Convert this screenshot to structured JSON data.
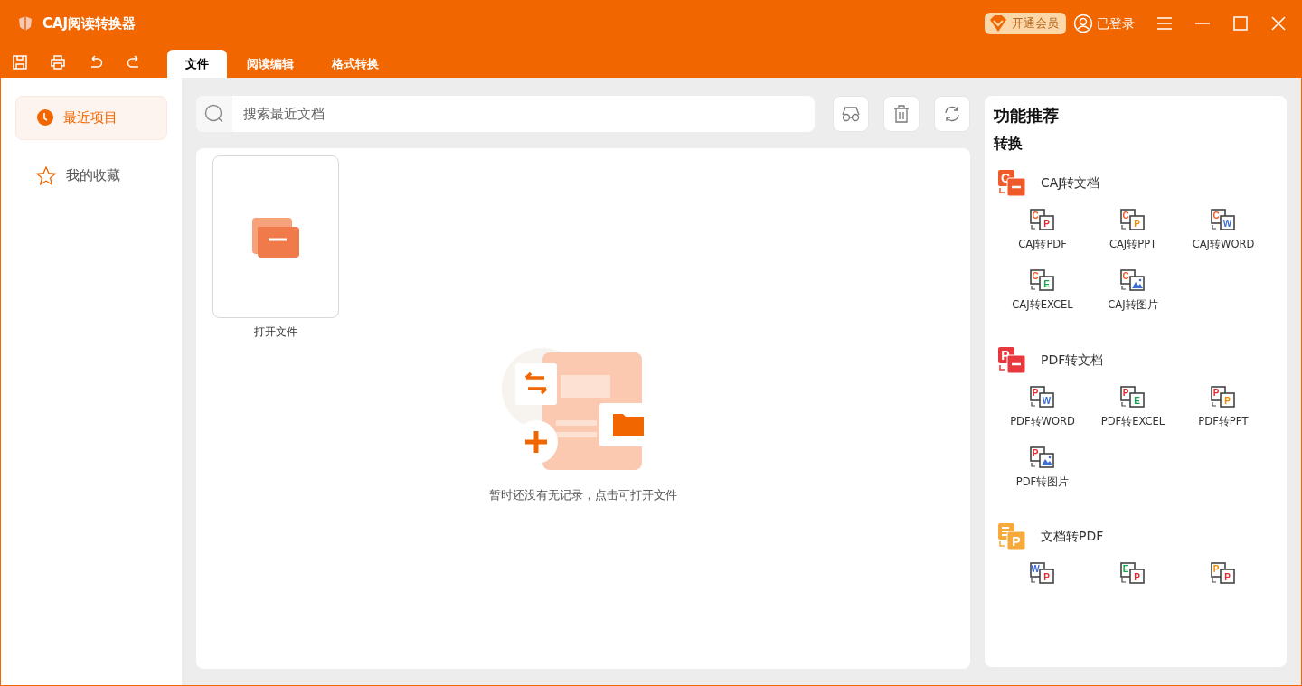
{
  "window": {
    "title": "CAJ阅读转换器",
    "vip_button": "开通会员",
    "user": "已登录"
  },
  "tabs": [
    {
      "label": "文件",
      "selected": true
    },
    {
      "label": "阅读编辑",
      "selected": false
    },
    {
      "label": "格式转换",
      "selected": false
    }
  ],
  "sidebar": {
    "items": [
      {
        "label": "最近项目",
        "kind": "clock",
        "selected": true
      },
      {
        "label": "我的收藏",
        "kind": "star",
        "selected": false
      }
    ]
  },
  "search": {
    "placeholder": "搜索最近文档"
  },
  "open_tile": {
    "label": "打开文件"
  },
  "empty_message": "暂时还没有无记录，点击可打开文件",
  "panel": {
    "title": "功能推荐",
    "subtitle": "转换",
    "sections": [
      {
        "title": "CAJ转文档",
        "color": "#f05a28",
        "icon_from": "C",
        "items": [
          {
            "label": "CAJ转PDF",
            "from": {
              "letter": "C",
              "color": "#f05a28"
            },
            "to": {
              "kind": "letter",
              "letter": "P",
              "color": "#e8262d"
            }
          },
          {
            "label": "CAJ转PPT",
            "from": {
              "letter": "C",
              "color": "#f05a28"
            },
            "to": {
              "kind": "letter",
              "letter": "P",
              "color": "#f08a00"
            }
          },
          {
            "label": "CAJ转WORD",
            "from": {
              "letter": "C",
              "color": "#f05a28"
            },
            "to": {
              "kind": "letter",
              "letter": "W",
              "color": "#3d6fd1"
            }
          },
          {
            "label": "CAJ转EXCEL",
            "from": {
              "letter": "C",
              "color": "#f05a28"
            },
            "to": {
              "kind": "letter",
              "letter": "E",
              "color": "#15a550"
            }
          },
          {
            "label": "CAJ转图片",
            "from": {
              "letter": "C",
              "color": "#f05a28"
            },
            "to": {
              "kind": "image"
            }
          }
        ]
      },
      {
        "title": "PDF转文档",
        "color": "#e8383d",
        "icon_from": "P",
        "items": [
          {
            "label": "PDF转WORD",
            "from": {
              "letter": "P",
              "color": "#e8262d"
            },
            "to": {
              "kind": "letter",
              "letter": "W",
              "color": "#3d6fd1"
            }
          },
          {
            "label": "PDF转EXCEL",
            "from": {
              "letter": "P",
              "color": "#e8262d"
            },
            "to": {
              "kind": "letter",
              "letter": "E",
              "color": "#15a550"
            }
          },
          {
            "label": "PDF转PPT",
            "from": {
              "letter": "P",
              "color": "#e8262d"
            },
            "to": {
              "kind": "letter",
              "letter": "P",
              "color": "#f08a00"
            }
          },
          {
            "label": "PDF转图片",
            "from": {
              "letter": "P",
              "color": "#e8262d"
            },
            "to": {
              "kind": "image"
            }
          }
        ]
      },
      {
        "title": "文档转PDF",
        "color": "#f7a93b",
        "icon_to": "P",
        "items": [
          {
            "from": {
              "letter": "W",
              "color": "#3d6fd1"
            },
            "to": {
              "kind": "letter",
              "letter": "P",
              "color": "#e8262d"
            }
          },
          {
            "from": {
              "letter": "E",
              "color": "#15a550"
            },
            "to": {
              "kind": "letter",
              "letter": "P",
              "color": "#e8262d"
            }
          },
          {
            "from": {
              "letter": "P",
              "color": "#f08a00"
            },
            "to": {
              "kind": "letter",
              "letter": "P",
              "color": "#e8262d"
            }
          }
        ]
      }
    ]
  }
}
